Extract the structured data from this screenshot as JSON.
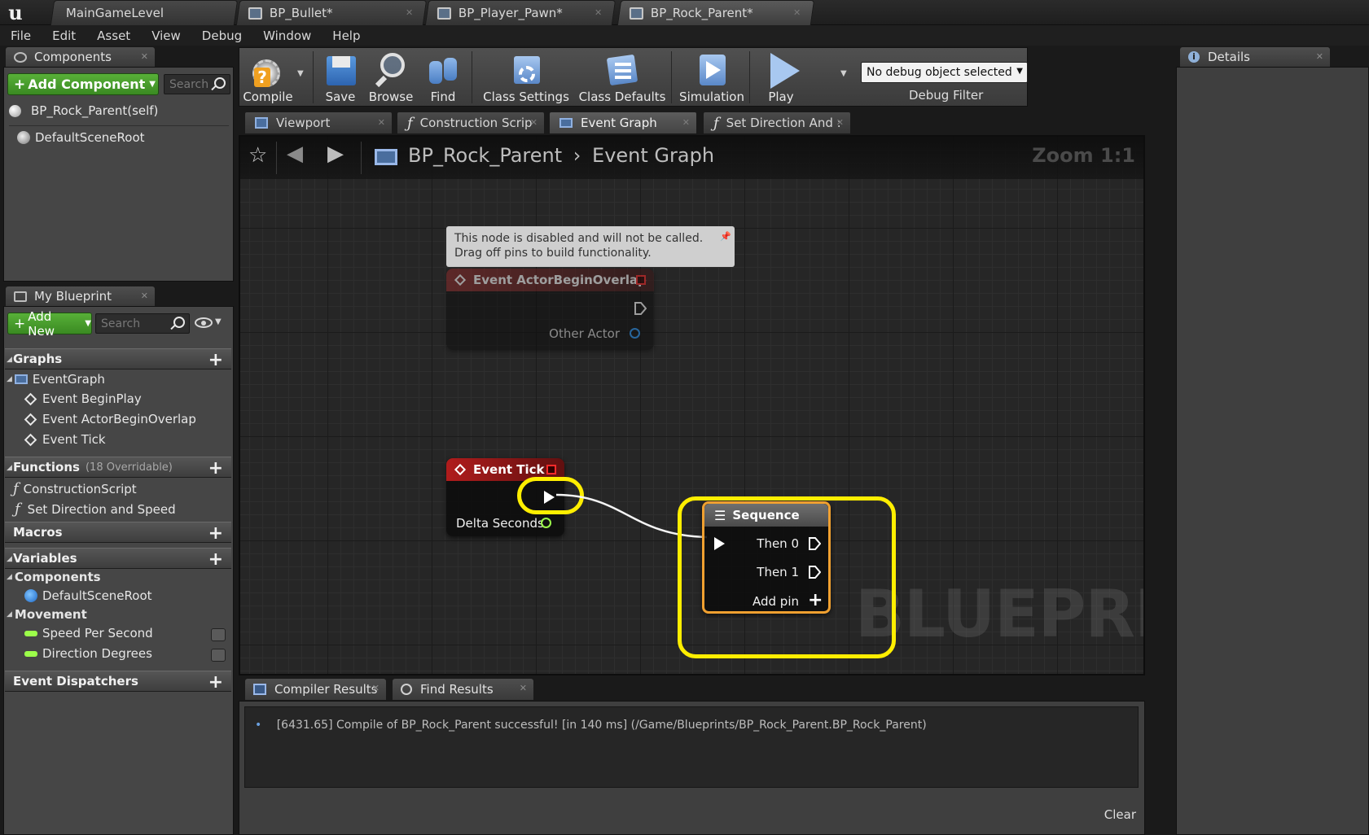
{
  "document_tabs": [
    {
      "label": "MainGameLevel",
      "active": false
    },
    {
      "label": "BP_Bullet*",
      "active": false
    },
    {
      "label": "BP_Player_Pawn*",
      "active": false
    },
    {
      "label": "BP_Rock_Parent*",
      "active": true
    }
  ],
  "menu": [
    "File",
    "Edit",
    "Asset",
    "View",
    "Debug",
    "Window",
    "Help"
  ],
  "components_panel": {
    "tab": "Components",
    "add_button": "Add Component",
    "search_placeholder": "Search",
    "items": [
      "BP_Rock_Parent(self)",
      "DefaultSceneRoot"
    ]
  },
  "my_blueprint": {
    "tab": "My Blueprint",
    "add_button": "Add New",
    "search_placeholder": "Search",
    "graphs_label": "Graphs",
    "graph_items": [
      "EventGraph",
      "Event BeginPlay",
      "Event ActorBeginOverlap",
      "Event Tick"
    ],
    "functions_label": "Functions",
    "functions_sub": "(18 Overridable)",
    "function_items": [
      "ConstructionScript",
      "Set Direction and Speed"
    ],
    "macros_label": "Macros",
    "variables_label": "Variables",
    "var_components_label": "Components",
    "var_component_items": [
      "DefaultSceneRoot"
    ],
    "movement_label": "Movement",
    "movement_items": [
      "Speed Per Second",
      "Direction Degrees"
    ],
    "dispatchers_label": "Event Dispatchers"
  },
  "toolbar": {
    "compile": "Compile",
    "save": "Save",
    "browse": "Browse",
    "find": "Find",
    "class_settings": "Class Settings",
    "class_defaults": "Class Defaults",
    "simulation": "Simulation",
    "play": "Play",
    "debug_select": "No debug object selected",
    "debug_filter": "Debug Filter"
  },
  "graph_tabs": [
    "Viewport",
    "Construction Scrip",
    "Event Graph",
    "Set Direction And :"
  ],
  "graph": {
    "crumb_root": "BP_Rock_Parent",
    "crumb_leaf": "Event Graph",
    "zoom": "Zoom 1:1",
    "watermark": "BLUEPRINT",
    "comment_line1": "This node is disabled and will not be called.",
    "comment_line2": "Drag off pins to build functionality.",
    "overlap_title": "Event ActorBeginOverlap",
    "overlap_pin": "Other Actor",
    "tick_title": "Event Tick",
    "tick_pin": "Delta Seconds",
    "seq_title": "Sequence",
    "seq_then0": "Then 0",
    "seq_then1": "Then 1",
    "seq_add": "Add pin"
  },
  "details_tab": "Details",
  "bottom": {
    "tabs": [
      "Compiler Results",
      "Find Results"
    ],
    "message": "[6431.65] Compile of BP_Rock_Parent successful! [in 140 ms] (/Game/Blueprints/BP_Rock_Parent.BP_Rock_Parent)",
    "clear": "Clear"
  },
  "colors": {
    "highlight": "#ffee00",
    "event_red": "#9a1515",
    "sequence_gray": "#555555",
    "pin_green": "#9cff4a",
    "pin_blue": "#2a9bff"
  }
}
